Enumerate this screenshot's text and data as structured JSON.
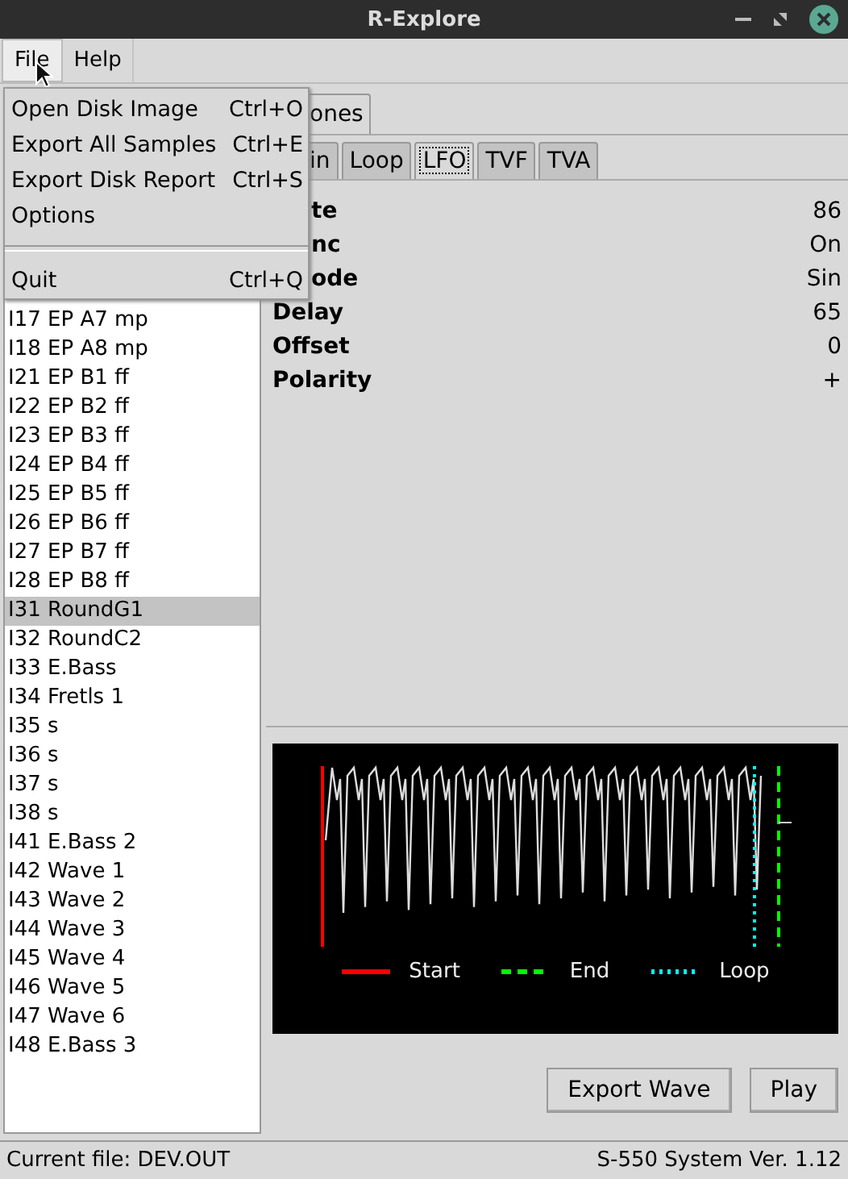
{
  "window": {
    "title": "R-Explore"
  },
  "menubar": [
    {
      "label": "File",
      "selected": true
    },
    {
      "label": "Help",
      "selected": false
    }
  ],
  "file_menu": {
    "items": [
      {
        "kind": "item",
        "label": "Open Disk Image",
        "shortcut": "Ctrl+O"
      },
      {
        "kind": "item",
        "label": "Export All Samples",
        "shortcut": "Ctrl+E"
      },
      {
        "kind": "item",
        "label": "Export Disk Report",
        "shortcut": "Ctrl+S"
      },
      {
        "kind": "item",
        "label": "Options"
      },
      {
        "kind": "separator"
      },
      {
        "kind": "item",
        "label": "Quit",
        "shortcut": "Ctrl+Q"
      }
    ]
  },
  "samples": [
    {
      "label": "I17 EP A7 mp",
      "selected": false
    },
    {
      "label": "I18 EP A8 mp",
      "selected": false
    },
    {
      "label": "I21 EP B1 ff",
      "selected": false
    },
    {
      "label": "I22 EP B2 ff",
      "selected": false
    },
    {
      "label": "I23 EP B3 ff",
      "selected": false
    },
    {
      "label": "I24 EP B4 ff",
      "selected": false
    },
    {
      "label": "I25 EP B5 ff",
      "selected": false
    },
    {
      "label": "I26 EP B6 ff",
      "selected": false
    },
    {
      "label": "I27 EP B7 ff",
      "selected": false
    },
    {
      "label": "I28 EP B8 ff",
      "selected": false
    },
    {
      "label": "I31 RoundG1",
      "selected": true
    },
    {
      "label": "I32 RoundC2",
      "selected": false
    },
    {
      "label": "I33 E.Bass",
      "selected": false
    },
    {
      "label": "I34 Fretls 1",
      "selected": false
    },
    {
      "label": "I35 s",
      "selected": false
    },
    {
      "label": "I36 s",
      "selected": false
    },
    {
      "label": "I37 s",
      "selected": false
    },
    {
      "label": "I38 s",
      "selected": false
    },
    {
      "label": "I41 E.Bass 2",
      "selected": false
    },
    {
      "label": "I42 Wave 1",
      "selected": false
    },
    {
      "label": "I43 Wave 2",
      "selected": false
    },
    {
      "label": "I44 Wave 3",
      "selected": false
    },
    {
      "label": "I45 Wave 4",
      "selected": false
    },
    {
      "label": "I46 Wave 5",
      "selected": false
    },
    {
      "label": "I47 Wave 6",
      "selected": false
    },
    {
      "label": "I48 E.Bass 3",
      "selected": false
    }
  ],
  "tabs": [
    {
      "label": "ones",
      "selected": true
    }
  ],
  "subtabs": [
    {
      "label": "in",
      "selected": false
    },
    {
      "label": "Loop",
      "selected": false
    },
    {
      "label": "LFO",
      "selected": true
    },
    {
      "label": "TVF",
      "selected": false
    },
    {
      "label": "TVA",
      "selected": false
    }
  ],
  "params": [
    {
      "name": "te",
      "value": "86",
      "cut": true
    },
    {
      "name": "nc",
      "value": "On",
      "cut": true
    },
    {
      "name": "ode",
      "value": "Sin",
      "cut": true
    },
    {
      "name": "Delay",
      "value": "65",
      "cut": false
    },
    {
      "name": "Offset",
      "value": "0",
      "cut": false
    },
    {
      "name": "Polarity",
      "value": "+",
      "cut": false
    }
  ],
  "waveform": {
    "legend": [
      {
        "label": "Start",
        "color": "#ff0000"
      },
      {
        "label": "End",
        "color": "#00ff00"
      },
      {
        "label": "Loop",
        "color": "#00ffff"
      }
    ]
  },
  "buttons": [
    "Export Wave",
    "Play"
  ],
  "status_bar": {
    "left": "Current file: DEV.OUT",
    "right": "S-550 System Ver. 1.12"
  }
}
